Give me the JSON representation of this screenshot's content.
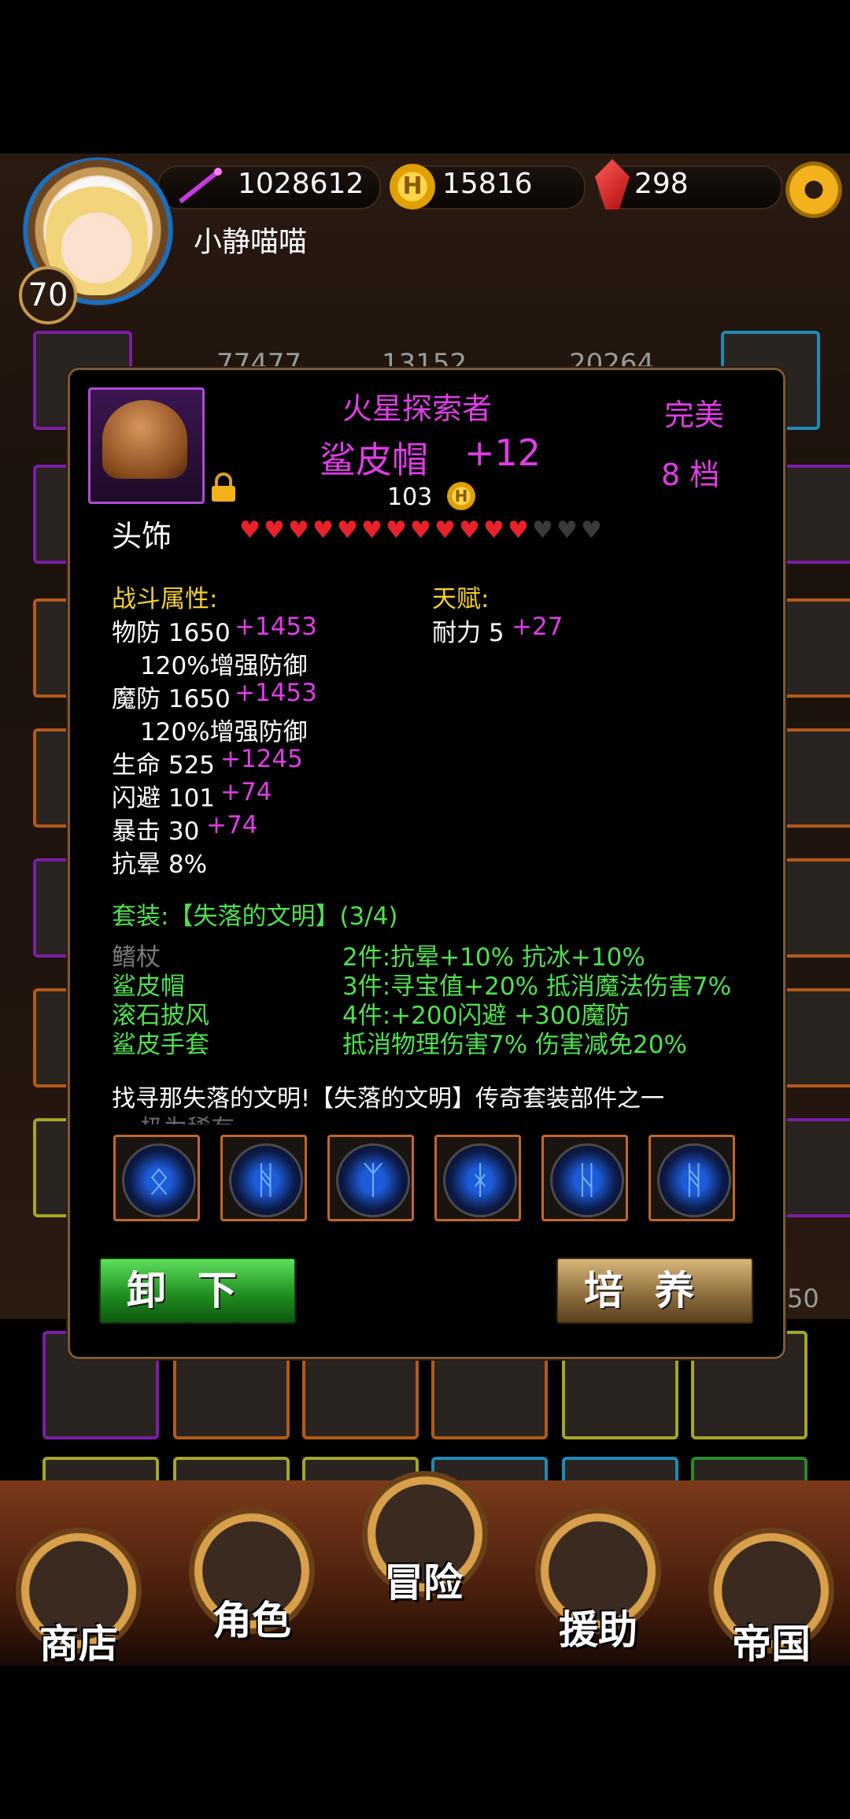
{
  "hud": {
    "power": "1028612",
    "gold": "15816",
    "gems": "298",
    "player_name": "小静喵喵",
    "level": "70",
    "bg_stats": [
      "77477",
      "13152",
      "20264"
    ],
    "bg_partial": "50"
  },
  "item": {
    "subtitle": "火星探索者",
    "name": "鲨皮帽",
    "enhance": "+12",
    "quality": "完美",
    "grade": "8 档",
    "price": "103",
    "slot": "头饰",
    "hearts_filled": 12,
    "hearts_total": 15,
    "colors": {
      "accent": "#e03de6",
      "heading": "#f2d12a",
      "set": "#4fe04f"
    }
  },
  "combat": {
    "heading": "战斗属性:",
    "stats": [
      {
        "label": "物防 1650",
        "bonus": "+1453"
      },
      {
        "label": "120%增强防御",
        "bonus": ""
      },
      {
        "label": "魔防 1650",
        "bonus": "+1453"
      },
      {
        "label": "120%增强防御",
        "bonus": ""
      },
      {
        "label": "生命 525",
        "bonus": "+1245"
      },
      {
        "label": "闪避 101",
        "bonus": "+74"
      },
      {
        "label": "暴击 30",
        "bonus": "+74"
      },
      {
        "label": "抗晕 8%",
        "bonus": ""
      }
    ]
  },
  "talent": {
    "heading": "天赋:",
    "label": "耐力 5",
    "bonus": "+27"
  },
  "set": {
    "heading": "套装:【失落的文明】(3/4)",
    "pieces": [
      "鳍杖",
      "鲨皮帽",
      "滚石披风",
      "鲨皮手套"
    ],
    "bonuses": [
      "2件:抗晕+10% 抗冰+10%",
      "3件:寻宝值+20% 抵消魔法伤害7%",
      "4件:+200闪避 +300魔防",
      "抵消物理伤害7% 伤害减免20%"
    ]
  },
  "description": "找寻那失落的文明!【失落的文明】传奇套装部件之一",
  "description_cut": "极为稀有",
  "buttons": {
    "unequip": "卸下",
    "train": "培养"
  },
  "nav": [
    "商店",
    "角色",
    "冒险",
    "援助",
    "帝国"
  ]
}
